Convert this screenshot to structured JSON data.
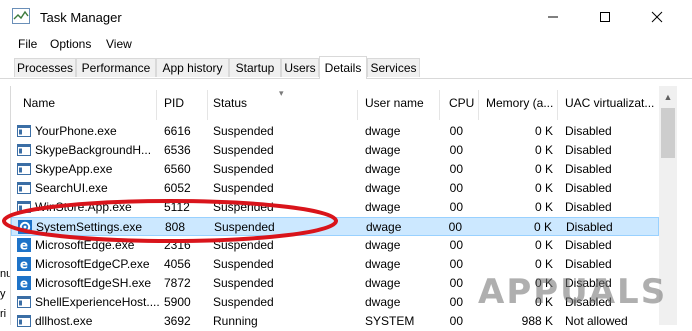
{
  "window": {
    "title": "Task Manager"
  },
  "menu": [
    "File",
    "Options",
    "View"
  ],
  "tabs": [
    "Processes",
    "Performance",
    "App history",
    "Startup",
    "Users",
    "Details",
    "Services"
  ],
  "active_tab": "Details",
  "columns": [
    "Name",
    "PID",
    "Status",
    "User name",
    "CPU",
    "Memory (a...",
    "UAC virtualizat..."
  ],
  "rows": [
    {
      "name": "YourPhone.exe",
      "pid": "6616",
      "status": "Suspended",
      "user": "dwage",
      "cpu": "00",
      "mem": "0 K",
      "uac": "Disabled",
      "icon": "app-window-icon"
    },
    {
      "name": "SkypeBackgroundH...",
      "pid": "6536",
      "status": "Suspended",
      "user": "dwage",
      "cpu": "00",
      "mem": "0 K",
      "uac": "Disabled",
      "icon": "app-window-icon"
    },
    {
      "name": "SkypeApp.exe",
      "pid": "6560",
      "status": "Suspended",
      "user": "dwage",
      "cpu": "00",
      "mem": "0 K",
      "uac": "Disabled",
      "icon": "app-window-icon"
    },
    {
      "name": "SearchUI.exe",
      "pid": "6052",
      "status": "Suspended",
      "user": "dwage",
      "cpu": "00",
      "mem": "0 K",
      "uac": "Disabled",
      "icon": "app-window-icon"
    },
    {
      "name": "WinStore.App.exe",
      "pid": "5112",
      "status": "Suspended",
      "user": "dwage",
      "cpu": "00",
      "mem": "0 K",
      "uac": "Disabled",
      "icon": "app-window-icon"
    },
    {
      "name": "SystemSettings.exe",
      "pid": "808",
      "status": "Suspended",
      "user": "dwage",
      "cpu": "00",
      "mem": "0 K",
      "uac": "Disabled",
      "icon": "gear-icon",
      "selected": true
    },
    {
      "name": "MicrosoftEdge.exe",
      "pid": "2316",
      "status": "Suspended",
      "user": "dwage",
      "cpu": "00",
      "mem": "0 K",
      "uac": "Disabled",
      "icon": "edge-icon"
    },
    {
      "name": "MicrosoftEdgeCP.exe",
      "pid": "4056",
      "status": "Suspended",
      "user": "dwage",
      "cpu": "00",
      "mem": "0 K",
      "uac": "Disabled",
      "icon": "edge-icon"
    },
    {
      "name": "MicrosoftEdgeSH.exe",
      "pid": "7872",
      "status": "Suspended",
      "user": "dwage",
      "cpu": "00",
      "mem": "0 K",
      "uac": "Disabled",
      "icon": "edge-icon"
    },
    {
      "name": "ShellExperienceHost....",
      "pid": "5900",
      "status": "Suspended",
      "user": "dwage",
      "cpu": "00",
      "mem": "0 K",
      "uac": "Disabled",
      "icon": "app-window-icon"
    },
    {
      "name": "dllhost.exe",
      "pid": "3692",
      "status": "Running",
      "user": "SYSTEM",
      "cpu": "00",
      "mem": "988 K",
      "uac": "Not allowed",
      "icon": "app-window-icon"
    }
  ],
  "left_edge_fragments": [
    "nu",
    "y",
    "ri"
  ],
  "watermark": "APPUALS",
  "colors": {
    "selection": "#cce8ff",
    "annotation_oval": "#d9141b",
    "edge_blue": "#1e73c8"
  }
}
